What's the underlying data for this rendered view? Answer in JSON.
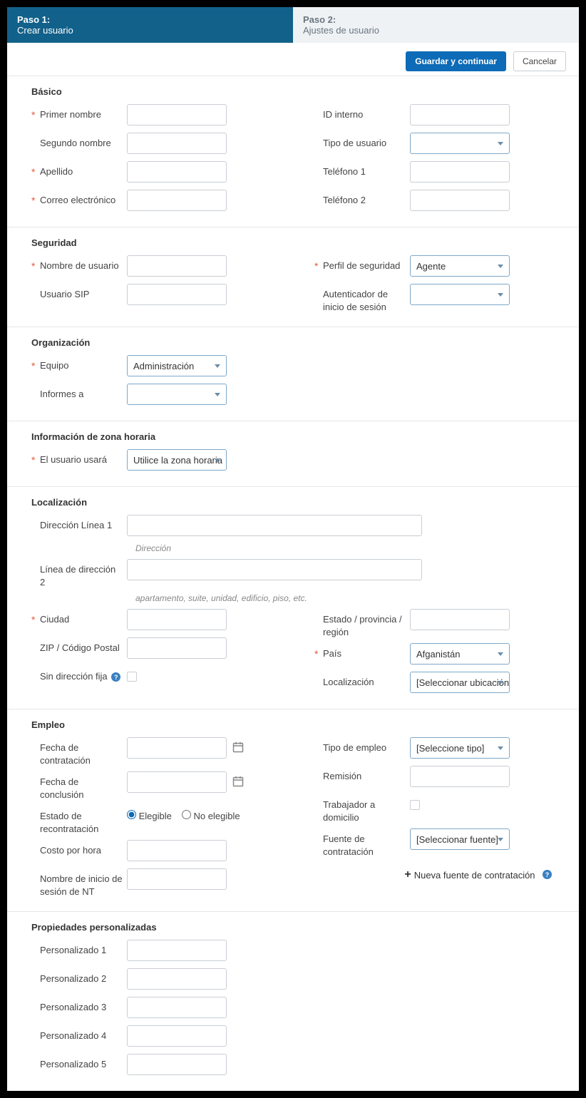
{
  "steps": {
    "step1_title": "Paso 1:",
    "step1_sub": "Crear usuario",
    "step2_title": "Paso 2:",
    "step2_sub": "Ajustes de usuario"
  },
  "buttons": {
    "save": "Guardar y continuar",
    "cancel": "Cancelar"
  },
  "sections": {
    "basic": {
      "title": "Básico",
      "first_name": "Primer nombre",
      "middle_name": "Segundo nombre",
      "last_name": "Apellido",
      "email": "Correo electrónico",
      "internal_id": "ID interno",
      "user_type": "Tipo de usuario",
      "phone1": "Teléfono 1",
      "phone2": "Teléfono 2"
    },
    "security": {
      "title": "Seguridad",
      "username": "Nombre de usuario",
      "sip_user": "Usuario SIP",
      "security_profile": "Perfil de seguridad",
      "security_profile_value": "Agente",
      "login_auth": "Autenticador de inicio de sesión"
    },
    "organization": {
      "title": "Organización",
      "team": "Equipo",
      "team_value": "Administración",
      "reports_to": "Informes a"
    },
    "timezone": {
      "title": "Información de zona horaria",
      "user_will_use": "El usuario usará",
      "user_will_use_value": "Utilice la zona horaria"
    },
    "location": {
      "title": "Localización",
      "addr1": "Dirección Línea 1",
      "addr1_hint": "Dirección",
      "addr2": "Línea de dirección 2",
      "addr2_hint": "apartamento, suite, unidad, edificio, piso, etc.",
      "city": "Ciudad",
      "zip": "ZIP / Código Postal",
      "no_fixed": "Sin dirección fija",
      "state": "Estado / provincia / región",
      "country": "País",
      "country_value": "Afganistán",
      "location": "Localización",
      "location_value": "[Seleccionar ubicación]"
    },
    "employment": {
      "title": "Empleo",
      "hire_date": "Fecha de contratación",
      "end_date": "Fecha de conclusión",
      "rehire_status": "Estado de recontratación",
      "eligible": "Elegible",
      "not_eligible": "No elegible",
      "hourly_cost": "Costo por hora",
      "nt_login": "Nombre de inicio de sesión de NT",
      "emp_type": "Tipo de empleo",
      "emp_type_value": "[Seleccione tipo]",
      "referral": "Remisión",
      "home_worker": "Trabajador a domicilio",
      "hire_source": "Fuente de contratación",
      "hire_source_value": "[Seleccionar fuente]",
      "new_hire_source": "Nueva fuente de contratación"
    },
    "custom": {
      "title": "Propiedades personalizadas",
      "c1": "Personalizado 1",
      "c2": "Personalizado 2",
      "c3": "Personalizado 3",
      "c4": "Personalizado 4",
      "c5": "Personalizado 5"
    }
  }
}
